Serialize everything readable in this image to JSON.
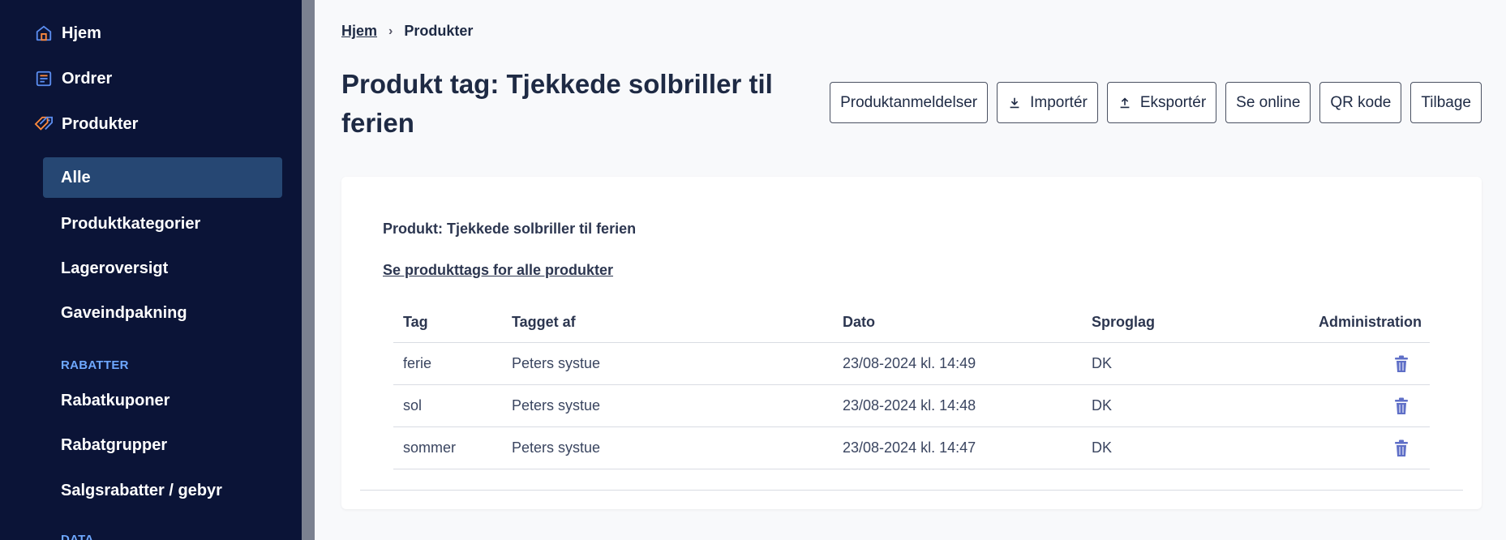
{
  "sidebar": {
    "items": [
      {
        "label": "Hjem",
        "icon": "home-icon"
      },
      {
        "label": "Ordrer",
        "icon": "orders-icon"
      },
      {
        "label": "Produkter",
        "icon": "tag-icon"
      }
    ],
    "sub_items": [
      {
        "label": "Alle",
        "active": true
      },
      {
        "label": "Produktkategorier"
      },
      {
        "label": "Lageroversigt"
      },
      {
        "label": "Gaveindpakning"
      }
    ],
    "section_rabatter": "RABATTER",
    "rabat_items": [
      {
        "label": "Rabatkuponer"
      },
      {
        "label": "Rabatgrupper"
      },
      {
        "label": "Salgsrabatter / gebyr"
      }
    ],
    "section_data": "DATA"
  },
  "breadcrumb": {
    "home": "Hjem",
    "current": "Produkter"
  },
  "page_title": "Produkt tag: Tjekkede solbriller til ferien",
  "toolbar": {
    "reviews": "Produktanmeldelser",
    "import": "Importér",
    "export": "Eksportér",
    "view_online": "Se online",
    "qr": "QR kode",
    "back": "Tilbage"
  },
  "card": {
    "title": "Produkt: Tjekkede solbriller til ferien",
    "link": "Se produkttags for alle produkter"
  },
  "table": {
    "headers": [
      "Tag",
      "Tagget af",
      "Dato",
      "Sproglag",
      "Administration"
    ],
    "rows": [
      {
        "tag": "ferie",
        "by": "Peters systue",
        "date": "23/08-2024 kl. 14:49",
        "lang": "DK"
      },
      {
        "tag": "sol",
        "by": "Peters systue",
        "date": "23/08-2024 kl. 14:48",
        "lang": "DK"
      },
      {
        "tag": "sommer",
        "by": "Peters systue",
        "date": "23/08-2024 kl. 14:47",
        "lang": "DK"
      }
    ]
  },
  "colors": {
    "sidebar_bg": "#0b1437",
    "active_bg": "#264773",
    "accent_blue": "#6ea8ff",
    "trash_icon": "#5f6fc7"
  }
}
